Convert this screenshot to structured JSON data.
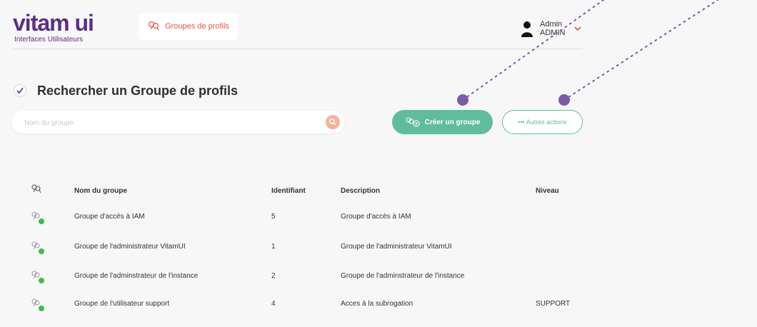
{
  "header": {
    "logo_main": "vitam ui",
    "logo_sub": "Interfaces Utilisateurs",
    "app_tab_label": "Groupes de profils",
    "user_name": "Admin",
    "user_role": "ADMIN"
  },
  "page": {
    "title": "Rechercher un Groupe de profils"
  },
  "search": {
    "placeholder": "Nom du groupe"
  },
  "actions": {
    "create_label": "Créer un groupe",
    "other_label": "••• Autres actions"
  },
  "table": {
    "columns": [
      "Nom du groupe",
      "Identifiant",
      "Description",
      "Niveau"
    ],
    "rows": [
      {
        "name": "Groupe d'accès à IAM",
        "id": "5",
        "description": "Groupe d'accès à IAM",
        "level": ""
      },
      {
        "name": "Groupe de l'administrateur VitamUI",
        "id": "1",
        "description": "Groupe de l'administrateur VitamUI",
        "level": ""
      },
      {
        "name": "Groupe de l'adminstrateur de l'instance",
        "id": "2",
        "description": "Groupe de l'adminstrateur de l'instance",
        "level": ""
      },
      {
        "name": "Groupe de l'utilisateur support",
        "id": "4",
        "description": "Acces à la subrogation",
        "level": "SUPPORT"
      }
    ]
  },
  "colors": {
    "brand": "#5a2f86",
    "accent": "#e8553a",
    "primary_button": "#5fbc9e",
    "status_dot": "#33c24a",
    "annotation": "#7b5aa6"
  },
  "icons": {
    "app_tab": "key-group-icon",
    "title": "check-circle-icon",
    "search": "search-icon",
    "create": "key-plus-icon",
    "user": "user-icon",
    "row": "key-group-status-icon",
    "chevron": "chevron-down-icon"
  }
}
